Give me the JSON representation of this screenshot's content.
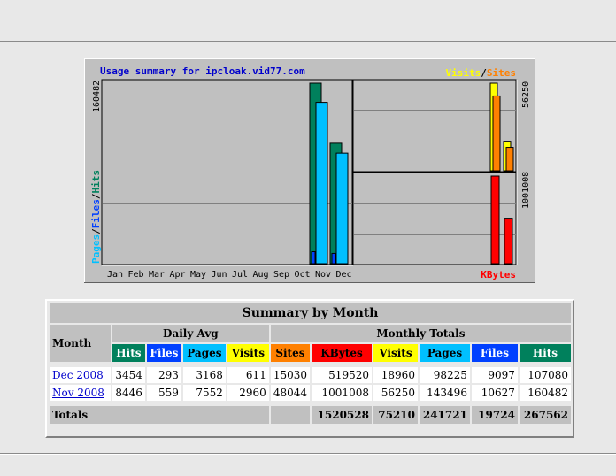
{
  "graph": {
    "title": "Usage summary for ipcloak.vid77.com",
    "left_axis_label_parts": {
      "pages": "Pages",
      "files": "Files",
      "hits": "Hits",
      "sep": "/"
    },
    "left_axis_max": "160482",
    "top_right_legend": {
      "visits": "Visits",
      "sep": "/",
      "sites": "Sites"
    },
    "top_right_axis_max": "56250",
    "bottom_right_axis_max": "1001008",
    "bottom_right_legend": "KBytes",
    "months": [
      "Jan",
      "Feb",
      "Mar",
      "Apr",
      "May",
      "Jun",
      "Jul",
      "Aug",
      "Sep",
      "Oct",
      "Nov",
      "Dec"
    ]
  },
  "chart_data": {
    "type": "bar",
    "categories": [
      "Jan",
      "Feb",
      "Mar",
      "Apr",
      "May",
      "Jun",
      "Jul",
      "Aug",
      "Sep",
      "Oct",
      "Nov",
      "Dec"
    ],
    "panels": [
      {
        "name": "Hits / Files / Pages",
        "ylim": [
          0,
          160482
        ],
        "series": [
          {
            "name": "Hits",
            "color": "#00805c",
            "points": {
              "Nov": 160482,
              "Dec": 107080
            }
          },
          {
            "name": "Files",
            "color": "#0040ff",
            "points": {
              "Nov": 10627,
              "Dec": 9097
            }
          },
          {
            "name": "Pages",
            "color": "#00c0ff",
            "points": {
              "Nov": 143496,
              "Dec": 98225
            }
          }
        ]
      },
      {
        "name": "Visits / Sites",
        "ylim": [
          0,
          56250
        ],
        "series": [
          {
            "name": "Visits",
            "color": "#ffff00",
            "points": {
              "Nov": 56250,
              "Dec": 18960
            }
          },
          {
            "name": "Sites",
            "color": "#ff8000",
            "points": {
              "Nov": 48044,
              "Dec": 15030
            }
          }
        ]
      },
      {
        "name": "KBytes",
        "ylim": [
          0,
          1001008
        ],
        "series": [
          {
            "name": "KBytes",
            "color": "#ff0000",
            "points": {
              "Nov": 1001008,
              "Dec": 519520
            }
          }
        ]
      }
    ]
  },
  "summary": {
    "caption": "Summary by Month",
    "month_header": "Month",
    "daily_avg_header": "Daily Avg",
    "monthly_totals_header": "Monthly Totals",
    "daily_cols": [
      {
        "label": "Hits",
        "bg": "#00805c",
        "fg": "#ffffff"
      },
      {
        "label": "Files",
        "bg": "#0040ff",
        "fg": "#ffffff"
      },
      {
        "label": "Pages",
        "bg": "#00c0ff",
        "fg": "#000000"
      },
      {
        "label": "Visits",
        "bg": "#ffff00",
        "fg": "#000000"
      }
    ],
    "monthly_cols": [
      {
        "label": "Sites",
        "bg": "#ff8000",
        "fg": "#000000"
      },
      {
        "label": "KBytes",
        "bg": "#ff0000",
        "fg": "#000000"
      },
      {
        "label": "Visits",
        "bg": "#ffff00",
        "fg": "#000000"
      },
      {
        "label": "Pages",
        "bg": "#00c0ff",
        "fg": "#000000"
      },
      {
        "label": "Files",
        "bg": "#0040ff",
        "fg": "#ffffff"
      },
      {
        "label": "Hits",
        "bg": "#00805c",
        "fg": "#ffffff"
      }
    ],
    "rows": [
      {
        "month": "Dec 2008",
        "values": [
          "3454",
          "293",
          "3168",
          "611",
          "15030",
          "519520",
          "18960",
          "98225",
          "9097",
          "107080"
        ]
      },
      {
        "month": "Nov 2008",
        "values": [
          "8446",
          "559",
          "7552",
          "2960",
          "48044",
          "1001008",
          "56250",
          "143496",
          "10627",
          "160482"
        ]
      }
    ],
    "totals": {
      "label": "Totals",
      "values": [
        "1520528",
        "75210",
        "241721",
        "19724",
        "267562"
      ]
    }
  }
}
